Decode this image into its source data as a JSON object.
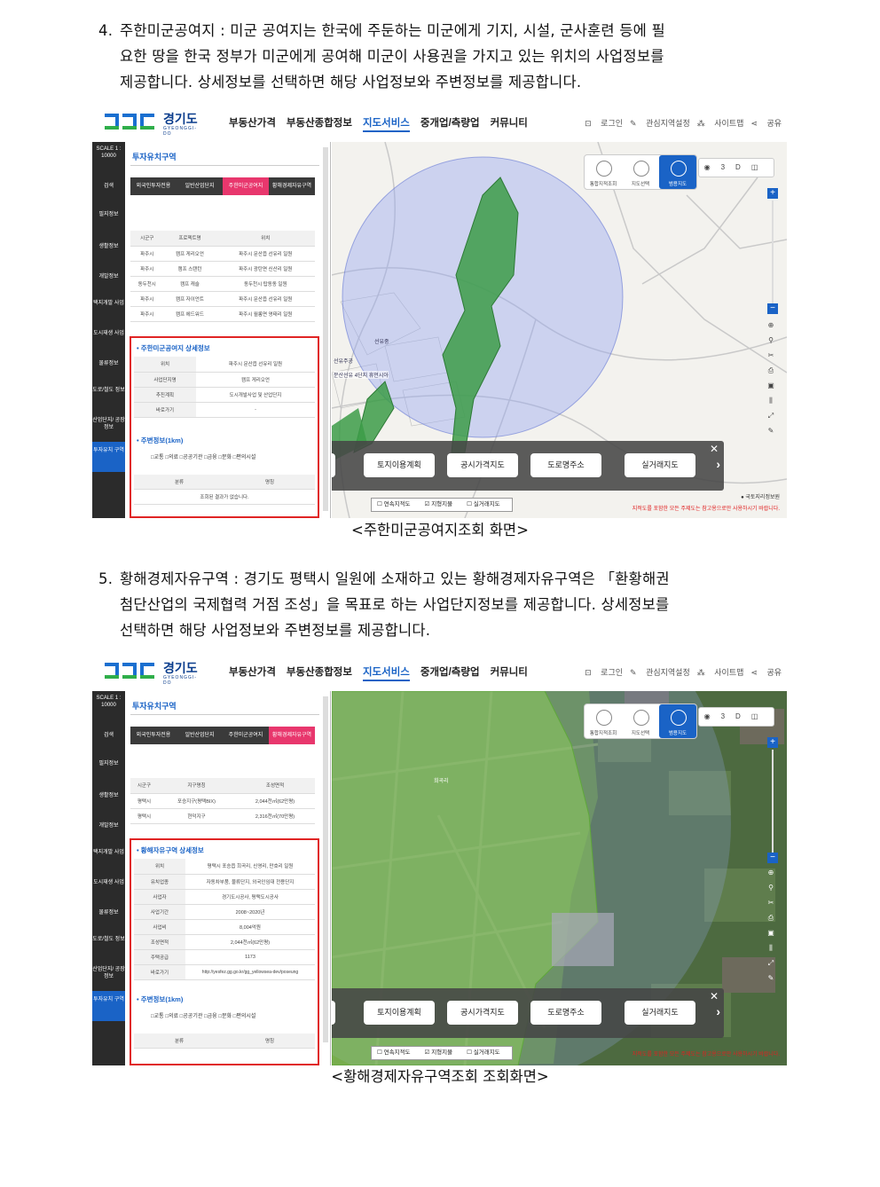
{
  "doc": {
    "item4": {
      "num": "4.",
      "line1": "주한미군공여지 : 미군 공여지는 한국에 주둔하는 미군에게 기지, 시설, 군사훈련 등에 필",
      "line2": "요한 땅을 한국 정부가 미군에게 공여해 미군이 사용권을 가지고 있는 위치의 사업정보를",
      "line3": "제공합니다.  상세정보를 선택하면 해당 사업정보와 주변정보를 제공합니다.",
      "caption": "<주한미군공여지조회 화면>"
    },
    "item5": {
      "num": "5.",
      "line1": "황해경제자유구역 : 경기도 평택시 일원에 소재하고 있는 황해경제자유구역은 「환황해권",
      "line2": "첨단산업의 국제협력 거점 조성」을 목표로 하는 사업단지정보를 제공합니다.  상세정보를",
      "line3": "선택하면 해당 사업정보와 주변정보를 제공합니다.",
      "caption": "<황해경제자유구역조회 조회화면>"
    }
  },
  "app": {
    "logo": "경기도",
    "logo_sub": "GYEONGGI-DO",
    "nav": [
      "부동산가격",
      "부동산종합정보",
      "지도서비스",
      "중개업/측량업",
      "커뮤니티"
    ],
    "util": [
      "로그인",
      "관심지역설정",
      "사이트맵",
      "공유"
    ],
    "side": [
      "SCALE 1 : 10000",
      "검색",
      "필지정보",
      "생활정보",
      "개발정보",
      "택지개발 사업",
      "도시재생 사업",
      "물류정보",
      "도로/철도 정보",
      "산업단지/ 공장정보",
      "투자유치 구역"
    ],
    "panel_title": "투자유치구역",
    "tabs": [
      "외국인투자전용",
      "일반산업단지",
      "주한미군공여지",
      "황해경제자유구역"
    ],
    "map_tools": [
      "통합지적조회",
      "지도선택",
      "범용지도"
    ],
    "layer_buttons": [
      "토지이용계획",
      "공시가격지도",
      "도로명주소",
      "실거래지도"
    ],
    "view_opts": [
      "연속지적도",
      "지형지물",
      "실거래지도"
    ],
    "near_title": "주변정보(1km)",
    "near_checks": "□교통 □의료 □공공기관 □금융 □문화 □편의시설",
    "near_head": [
      "분류",
      "명칭"
    ],
    "warn": "지적도를 포함한 모든 주제도는 참고용으로만 사용하시기 바랍니다."
  },
  "shot1": {
    "list_head": [
      "시군구",
      "프로젝트명",
      "위치"
    ],
    "list_rows": [
      [
        "파주시",
        "캠프 게리오언",
        "파주시 문산읍 선유리 일원"
      ],
      [
        "파주시",
        "캠프 스탠턴",
        "파주시 광탄면 신산리 일원"
      ],
      [
        "동두천시",
        "캠프 캐슬",
        "동두천시 탑동동 일원"
      ],
      [
        "파주시",
        "캠프 자이언트",
        "파주시 문산읍 선유리 일원"
      ],
      [
        "파주시",
        "캠프 에드워드",
        "파주시 월롱면 영태리 일원"
      ]
    ],
    "detail_title": "주한미군공여지 상세정보",
    "detail": [
      [
        "위치",
        "파주시 문산읍 선유리 일원"
      ],
      [
        "사업단지명",
        "캠프 게리오언"
      ],
      [
        "추진계획",
        "도시개발사업 및 산업단지"
      ],
      [
        "바로가기",
        "-"
      ]
    ],
    "empty": "조회된 결과가 없습니다.",
    "map_labels": [
      "선유중",
      "선유주공",
      "문산선유 4단지 휴먼시아"
    ],
    "copyright": "국토지리정보원"
  },
  "shot2": {
    "list_head": [
      "시군구",
      "지구명칭",
      "조성면적"
    ],
    "list_rows": [
      [
        "평택시",
        "포승지구(평택BIX)",
        "2,044천㎡(62만평)"
      ],
      [
        "평택시",
        "현덕지구",
        "2,316천㎡(70만평)"
      ]
    ],
    "detail_title": "황해자유구역 상세정보",
    "detail": [
      [
        "위치",
        "평택시 포승읍 희곡리, 신영리, 만호리 일원"
      ],
      [
        "유치업종",
        "자동차부품, 물류단지, 외국인임대 전용단지"
      ],
      [
        "사업자",
        "경기도시공사, 평택도시공사"
      ],
      [
        "사업기간",
        "2008~2020년"
      ],
      [
        "사업비",
        "8,004억원"
      ],
      [
        "조성면적",
        "2,044천㎡(62만평)"
      ],
      [
        "주택공급",
        "1173"
      ],
      [
        "바로가기",
        "http://yesfez.gg.go.kr/gg_yellowsea-dev/poseung"
      ]
    ],
    "map_labels": [
      "희곡리"
    ]
  }
}
